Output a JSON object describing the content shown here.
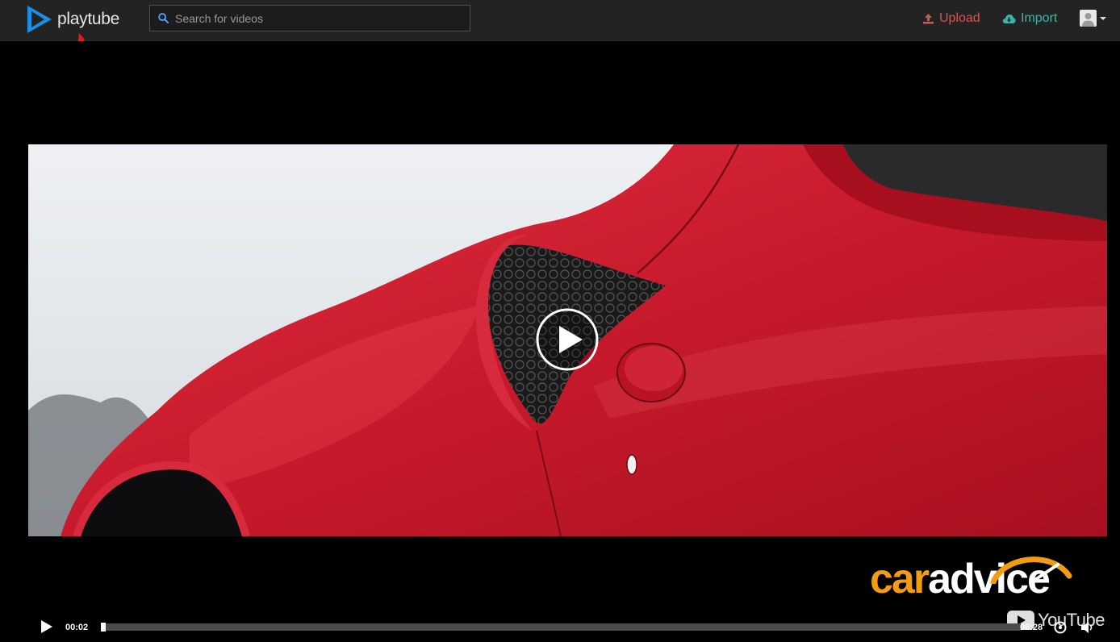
{
  "header": {
    "brand": "playtube",
    "search_placeholder": "Search for videos",
    "upload_label": "Upload",
    "import_label": "Import"
  },
  "player": {
    "current_time": "00:02",
    "duration": "06:28",
    "progress": 0.005
  },
  "overlay": {
    "watermark_part1": "car",
    "watermark_part2": "advice",
    "platform_logo": "YouTube"
  },
  "colors": {
    "upload": "#d9534f",
    "import": "#3ab4a8",
    "brand_blue": "#1e90ff",
    "watermark_orange": "#f39c12"
  }
}
